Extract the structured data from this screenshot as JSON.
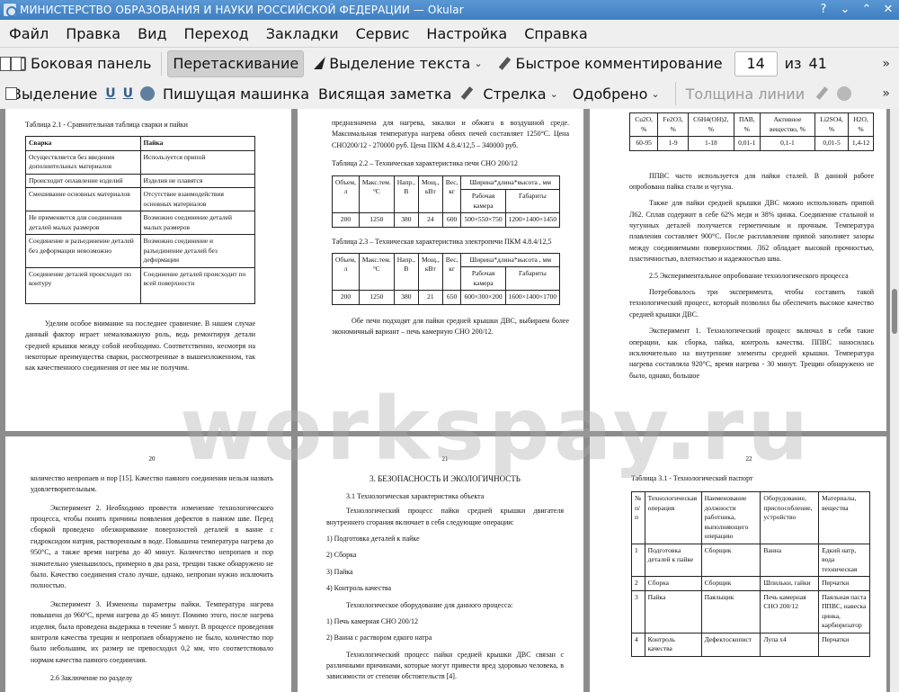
{
  "window": {
    "title": "МИНИСТЕРСТВО ОБРАЗОВАНИЯ И НАУКИ РОССИЙСКОЙ ФЕДЕРАЦИИ  — Okular",
    "btn_help": "?",
    "btn_min": "⌄",
    "btn_max": "⌃",
    "btn_close": "✕"
  },
  "menu": [
    "Файл",
    "Правка",
    "Вид",
    "Переход",
    "Закладки",
    "Сервис",
    "Настройка",
    "Справка"
  ],
  "toolbar1": {
    "sidebar": "Боковая панель",
    "drag": "Перетаскивание",
    "select_text": "Выделение текста",
    "quick_comment": "Быстрое комментирование",
    "page_value": "14",
    "of": "из",
    "total": "41"
  },
  "toolbar2": {
    "highlight": "Выделение",
    "typewriter": "Пишущая машинка",
    "note": "Висящая заметка",
    "arrow": "Стрелка",
    "stamp": "Одобрено",
    "line_width": "Толщина линии"
  },
  "watermark": "workspay.ru",
  "page1": {
    "caption": "Таблица 2.1 - Сравнительная таблица сварки и пайки",
    "headers": [
      "Сварка",
      "Пайка"
    ],
    "rows": [
      [
        "Осуществляется без введения дополнительных материалов",
        "Используется припой"
      ],
      [
        "Происходит оплавление изделий",
        "Изделия не плавятся"
      ],
      [
        "Смешивание основных материалов",
        "Отсутствие взаимодействия основных материалов"
      ],
      [
        "Не применяется для соединения деталей малых размеров",
        "Возможно соединение деталей малых размеров"
      ],
      [
        "Соединение и разъединение деталей без деформации невозможно",
        "Возможно соединение и разъединение деталей без деформации"
      ],
      [
        "Соединение деталей происходит по контуру",
        "Соединение деталей происходит по всей поверхности"
      ]
    ],
    "para": "Уделим особое внимание на последнее сравнение. В нашем случае данный фактор играет немаловажную роль, ведь ремонтируя детали средней крышки между собой необходимо. Соответственно, несмотря на некоторые преимущества сварки, рассмотренные в вышеизложенном, так как качественного соединения от нее мы не получим."
  },
  "page2": {
    "top_text": "предназначена для нагрева, закалки и обжига в воздушной среде. Максимальная температура нагрева обеих печей составляет 1250°С. Цена СНО200/12 - 270000 руб. Цена ПКМ 4.8.4/12,5 – 340000 руб.",
    "caption1": "Таблица 2.2 – Техническая характеристика печи СНО 200/12",
    "caption2": "Таблица 2.3 – Техническая характеристика электропечи ПКМ 4.8.4/12,5",
    "h_vol": "Объем, л",
    "h_temp": "Макс.тем. °С",
    "h_volt": "Напр., В",
    "h_power": "Мощ., кВт",
    "h_weight": "Вес, кг",
    "h_dims": "Ширина*длина*высота , мм",
    "h_chamber": "Рабочая камера",
    "h_overall": "Габариты",
    "t1": [
      "200",
      "1250",
      "380",
      "24",
      "600",
      "500×550×750",
      "1200×1400×1450"
    ],
    "t2": [
      "200",
      "1250",
      "380",
      "21",
      "650",
      "600×300×200",
      "1600×1400×1700"
    ],
    "para": "Обе печи подходят для пайки средней крышки ДВС, выбираем более экономичный вариант – печь камерную СНО 200/12."
  },
  "page3": {
    "headers": [
      "Cu2O, %",
      "Fe2O3, %",
      "C6H4(OH)2, %",
      "ПАВ, %",
      "Активное вещество, %",
      "Li2SO4, %",
      "H2O, %"
    ],
    "row": [
      "60-95",
      "1-9",
      "1-18",
      "0,01-1",
      "0,1-1",
      "0,01-5",
      "1,4-12"
    ],
    "p1": "ППВС часто используется для пайки сталей. В данной работе опробована пайка стали и чугуна.",
    "p2": "Также для пайки средней крышки ДВС можно использовать припой Л62. Сплав содержит в себе 62% меди и 38% цинка. Соединение стальной и чугунных деталей получается герметичным и прочным. Температура плавления составляет 900°С. После расплавления припой заполняет зазоры между соединяемыми поверхностями. Л62 обладает высокой прочностью, пластичностью, плотностью и надежностью шва.",
    "sub": "2.5 Экспериментальное опробование технологического процесса",
    "p3": "Потребовалось три эксперимента, чтобы составить такой технологический процесс, который позволил бы обеспечить высокое качество средней крышки ДВС.",
    "p4": "Эксперимент 1. Технологический процесс включал в себя такие операции, как сборка, пайка, контроль качества. ППВС наносилась исключительно на внутренние элементы средней крышки. Температура нагрева составляла 920°С, время нагрева - 30 минут. Трещин обнаружено не было, однако, большое"
  },
  "page4": {
    "num": "20",
    "p1": "количество непропаев и пор [15]. Качество паяного соединения нельзя назвать удовлетворительным.",
    "p2": "Эксперимент 2. Необходимо провести изменение технологического процесса, чтобы понять причины появления дефектов в паяном шве. Перед сборкой проведено обезжиривание поверхностей деталей в ванне с гидроксидом натрия, растворенным в воде. Повышена температура нагрева до 950°С, а также время нагрева до 40 минут. Количество непропаев и пор значительно уменьшилось, примерно в два раза, трещин также обнаружено не было. Качество соединения стало лучше, однако, непропаи нужно исключить полностью.",
    "p3": "Эксперимент 3. Изменены параметры пайки. Температура нагрева повышена до 960°С, время нагрева до 45 минут. Помимо этого, после нагрева изделия, была проведена выдержка в течение 5 минут. В процессе проведения контроля качества трещин и непропаев обнаружено не было, количество пор было небольшим, их размер не превосходил 0,2 мм, что соответствовало нормам качества паяного соединения.",
    "sub": "2.6 Заключение по разделу"
  },
  "page5": {
    "num": "21",
    "title": "3. БЕЗОПАСНОСТЬ И ЭКОЛОГИЧНОСТЬ",
    "sub": "3.1 Технологическая характеристика объекта",
    "p1": "Технологический процесс пайки средней крышки двигателя внутреннего сгорания включает в себя следующие операции:",
    "items": [
      "1) Подготовка деталей к пайке",
      "2) Сборка",
      "3) Пайка",
      "4) Контроль качества"
    ],
    "p2": "Технологическое оборудование для данного процесса:",
    "equip": [
      "1) Печь камерная СНО 200/12",
      "2) Ванна с раствором едкого натра"
    ],
    "p3": "Технологический процесс пайки средней крышки ДВС связан с различными причинами, которые могут привести вред здоровью человека, в зависимости от степени обстоятельств [4]."
  },
  "page6": {
    "num": "22",
    "caption": "Таблица 3.1 - Технологический паспорт",
    "headers": [
      "№ п/п",
      "Технологическая операция",
      "Наименование должности работника, выполняющего операцию",
      "Оборудование, приспособление, устройство",
      "Материалы, вещества"
    ],
    "rows": [
      [
        "1",
        "Подготовка деталей к пайке",
        "Сборщик",
        "Ванна",
        "Едкий натр, вода техническая"
      ],
      [
        "2",
        "Сборка",
        "Сборщик",
        "Шпильки, гайки",
        "Перчатки"
      ],
      [
        "3",
        "Пайка",
        "Паяльщик",
        "Печь камерная СНО 200/12",
        "Паяльная паста ППВС, навеска цинка, карбюризатор"
      ],
      [
        "4",
        "Контроль качества",
        "Дефектоскопист",
        "Лупа х4",
        "Перчатки"
      ]
    ]
  }
}
